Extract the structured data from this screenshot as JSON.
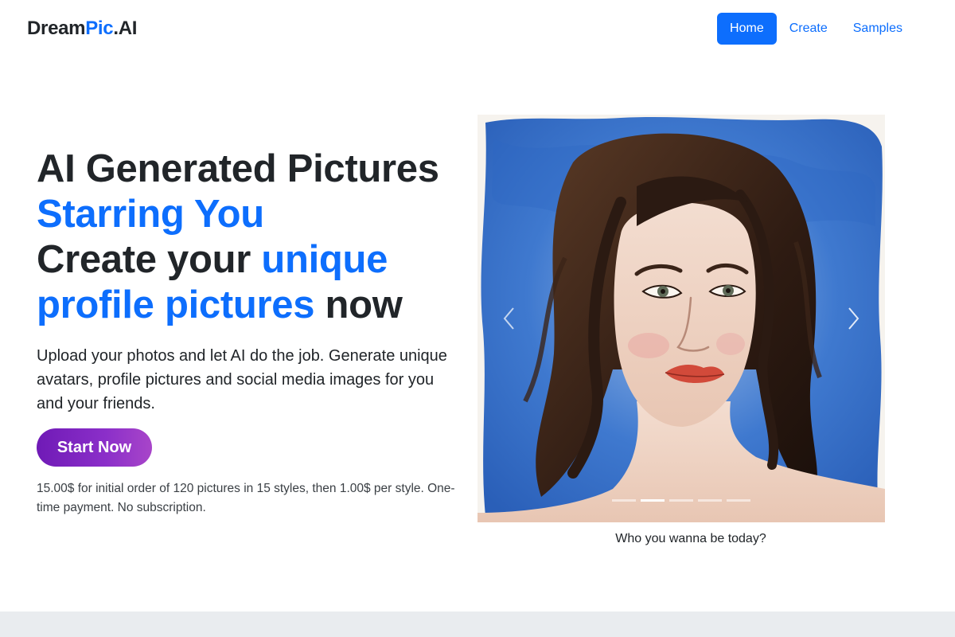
{
  "brand": {
    "part1": "Dream",
    "part2": "Pic",
    "part3": ".AI",
    "accent_color": "#0d6efd"
  },
  "nav": {
    "items": [
      {
        "label": "Home",
        "active": true
      },
      {
        "label": "Create",
        "active": false
      },
      {
        "label": "Samples",
        "active": false
      }
    ]
  },
  "hero": {
    "line1": "AI Generated Pictures",
    "line2": "Starring You",
    "line3a": "Create your ",
    "line3b": "unique",
    "line4a": "profile pictures",
    "line4b": " now",
    "lead": "Upload your photos and let AI do the job. Generate unique avatars, profile pictures and social media images for you and your friends.",
    "cta_label": "Start Now",
    "price_note": "15.00$ for initial order of 120 pictures in 15 styles, then 1.00$ per style. One-time payment. No subscription."
  },
  "carousel": {
    "caption": "Who you wanna be today?",
    "slide_count": 5,
    "active_index": 1,
    "prev_icon": "chevron-left-icon",
    "next_icon": "chevron-right-icon"
  },
  "colors": {
    "primary": "#0d6efd",
    "cta_gradient_start": "#6f1ab6",
    "cta_gradient_end": "#a845c9",
    "footer_band": "#e9ecef"
  }
}
